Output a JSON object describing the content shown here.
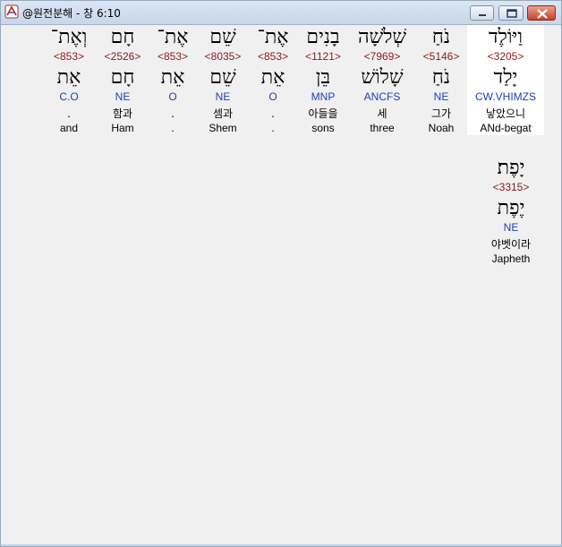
{
  "window": {
    "title": "@원전분해 - 창 6:10"
  },
  "words": [
    {
      "hebrew": "וַיּוֹלֶד",
      "strong": "<3205>",
      "lemma": "יָלַד",
      "morph": "CW.VHIMZS",
      "korean": "낳았으니",
      "english": "ANd-begat"
    },
    {
      "hebrew": "נֹחַ",
      "strong": "<5146>",
      "lemma": "נֹחַ",
      "morph": "NE",
      "korean": "그가",
      "english": "Noah"
    },
    {
      "hebrew": "שְׁלֹשָׁה",
      "strong": "<7969>",
      "lemma": "שָׁלוֹשׁ",
      "morph": "ANCFS",
      "korean": "세",
      "english": "three"
    },
    {
      "hebrew": "בָנִים",
      "strong": "<1121>",
      "lemma": "בֵּן",
      "morph": "MNP",
      "korean": "아들을",
      "english": "sons"
    },
    {
      "hebrew": "אֶת־",
      "strong": "<853>",
      "lemma": "אֵת",
      "morph": "O",
      "korean": ".",
      "english": "."
    },
    {
      "hebrew": "שֵׁם",
      "strong": "<8035>",
      "lemma": "שֵׁם",
      "morph": "NE",
      "korean": "셈과",
      "english": "Shem"
    },
    {
      "hebrew": "אֶת־",
      "strong": "<853>",
      "lemma": "אֵת",
      "morph": "O",
      "korean": ".",
      "english": "."
    },
    {
      "hebrew": "חָם",
      "strong": "<2526>",
      "lemma": "חָם",
      "morph": "NE",
      "korean": "함과",
      "english": "Ham"
    },
    {
      "hebrew": "וְאֶת־",
      "strong": "<853>",
      "lemma": "אֵת",
      "morph": "C.O",
      "korean": ".",
      "english": "and"
    },
    {
      "hebrew": "יָפֶת׃",
      "strong": "<3315>",
      "lemma": "יֶפֶת",
      "morph": "NE",
      "korean": "야벳이라",
      "english": "Japheth"
    }
  ]
}
